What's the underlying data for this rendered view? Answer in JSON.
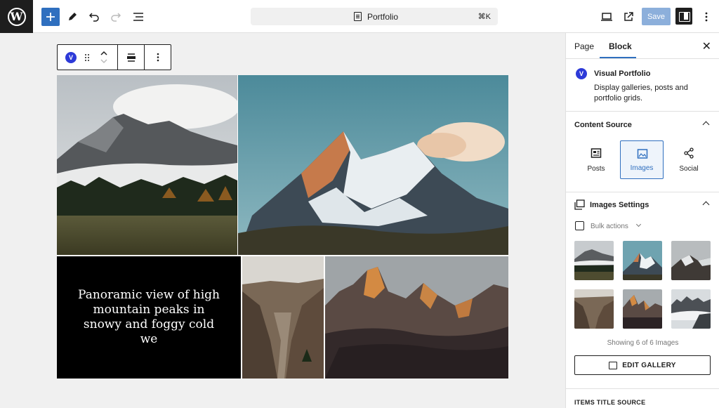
{
  "header": {
    "document_title": "Portfolio",
    "shortcut": "⌘K",
    "save_label": "Save",
    "icons": [
      "wordpress-logo",
      "plus",
      "pencil",
      "undo",
      "redo",
      "list-view",
      "laptop-preview",
      "external-link",
      "settings-sidebar",
      "more-vertical"
    ]
  },
  "block_toolbar": {
    "badge": "V"
  },
  "gallery": {
    "caption": "Panoramic view of high mountain peaks in snowy and foggy cold we"
  },
  "sidebar": {
    "tabs": [
      {
        "label": "Page"
      },
      {
        "label": "Block"
      }
    ],
    "block": {
      "badge": "V",
      "name": "Visual Portfolio",
      "description": "Display galleries, posts and portfolio grids."
    },
    "content_source": {
      "title": "Content Source",
      "options": [
        {
          "label": "Posts"
        },
        {
          "label": "Images"
        },
        {
          "label": "Social"
        }
      ],
      "selected": "Images"
    },
    "images_settings": {
      "title": "Images Settings",
      "bulk_actions": "Bulk actions",
      "showing": "Showing 6 of 6 Images",
      "edit_gallery": "EDIT GALLERY"
    },
    "items_title_source": "ITEMS TITLE SOURCE"
  },
  "colors": {
    "accent": "#2f6fbf",
    "vp_badge": "#2d3ad8",
    "dark": "#1e1e1e"
  }
}
